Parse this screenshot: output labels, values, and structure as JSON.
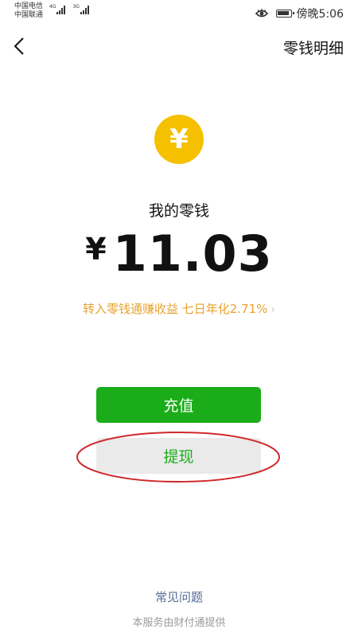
{
  "status_bar": {
    "carrier_1": "中国电信",
    "carrier_2": "中国联通",
    "network_1": "4G",
    "network_2": "3G",
    "time": "傍晚5:06"
  },
  "nav": {
    "back_icon": "chevron-left-icon",
    "details_link": "零钱明细"
  },
  "coin": {
    "icon": "yuan-coin-icon",
    "symbol": "¥",
    "color": "#f5c000"
  },
  "balance": {
    "label": "我的零钱",
    "currency": "¥",
    "amount": "11.03"
  },
  "yield_link": {
    "text": "转入零钱通赚收益 七日年化2.71%",
    "chevron": "›",
    "color": "#e8a22e"
  },
  "buttons": {
    "recharge": "充值",
    "withdraw": "提现",
    "primary_color": "#1aad19"
  },
  "footer": {
    "faq": "常见问题",
    "provider": "本服务由财付通提供"
  },
  "annotation": {
    "color": "#d0292b"
  }
}
